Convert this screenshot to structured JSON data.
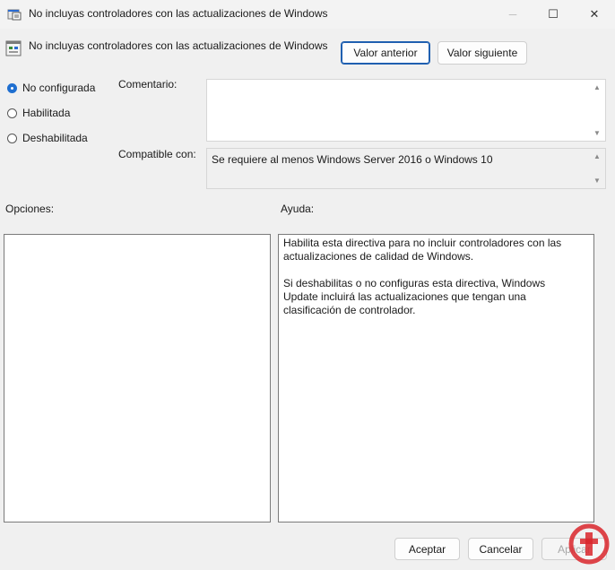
{
  "window": {
    "title": "No incluyas controladores con las actualizaciones de Windows",
    "controls": {
      "minimize": "─",
      "maximize": "☐",
      "close": "✕"
    }
  },
  "header": {
    "policy_title": "No incluyas controladores con las actualizaciones de Windows",
    "prev_label": "Valor anterior",
    "next_label": "Valor siguiente"
  },
  "state": {
    "options": [
      {
        "label": "No configurada",
        "selected": true
      },
      {
        "label": "Habilitada",
        "selected": false
      },
      {
        "label": "Deshabilitada",
        "selected": false
      }
    ]
  },
  "comment": {
    "label": "Comentario:",
    "value": ""
  },
  "supported": {
    "label": "Compatible con:",
    "value": "Se requiere al menos Windows Server 2016 o Windows 10"
  },
  "sections": {
    "options_label": "Opciones:",
    "help_label": "Ayuda:"
  },
  "help": {
    "p1": "Habilita esta directiva para no incluir controladores con las actualizaciones de calidad de Windows.",
    "p2": "Si deshabilitas o no configuras esta directiva, Windows Update incluirá las actualizaciones que tengan una clasificación de controlador."
  },
  "footer": {
    "ok_label": "Aceptar",
    "cancel_label": "Cancelar",
    "apply_label": "Aplicar"
  },
  "colors": {
    "accent": "#1f6fd0",
    "logo": "#d9262b"
  },
  "icons": {
    "title": "policy-window-icon",
    "policy": "policy-setting-icon",
    "scroll_up": "arrow-up-icon",
    "scroll_down": "arrow-down-icon",
    "watermark": "logo-icon"
  }
}
